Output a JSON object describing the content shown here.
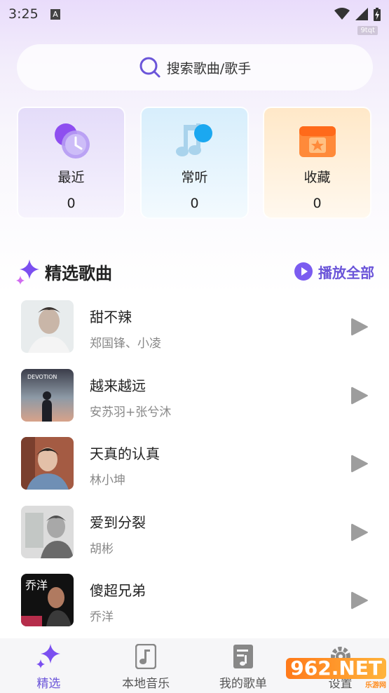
{
  "status_bar": {
    "time": "3:25",
    "notification_letter": "A",
    "watermark": "9tqt"
  },
  "search": {
    "placeholder": "搜索歌曲/歌手"
  },
  "categories": [
    {
      "label": "最近",
      "count": "0"
    },
    {
      "label": "常听",
      "count": "0"
    },
    {
      "label": "收藏",
      "count": "0"
    }
  ],
  "section": {
    "title": "精选歌曲",
    "play_all": "播放全部"
  },
  "songs": [
    {
      "title": "甜不辣",
      "artist": "郑国锋、小凌"
    },
    {
      "title": "越来越远",
      "artist": "安苏羽+张兮沐",
      "cover_text": "DEVOTION"
    },
    {
      "title": "天真的认真",
      "artist": "林小坤"
    },
    {
      "title": "爱到分裂",
      "artist": "胡彬"
    },
    {
      "title": "傻超兄弟",
      "artist": "乔洋",
      "cover_text": "乔洋"
    }
  ],
  "bottom_nav": [
    {
      "label": "精选"
    },
    {
      "label": "本地音乐"
    },
    {
      "label": "我的歌单"
    },
    {
      "label": "设置"
    }
  ],
  "watermark_logo": {
    "big": "962.NET",
    "small": "乐游网"
  },
  "colors": {
    "accent": "#6b55d9",
    "text": "#222222",
    "subtext": "#888888"
  }
}
